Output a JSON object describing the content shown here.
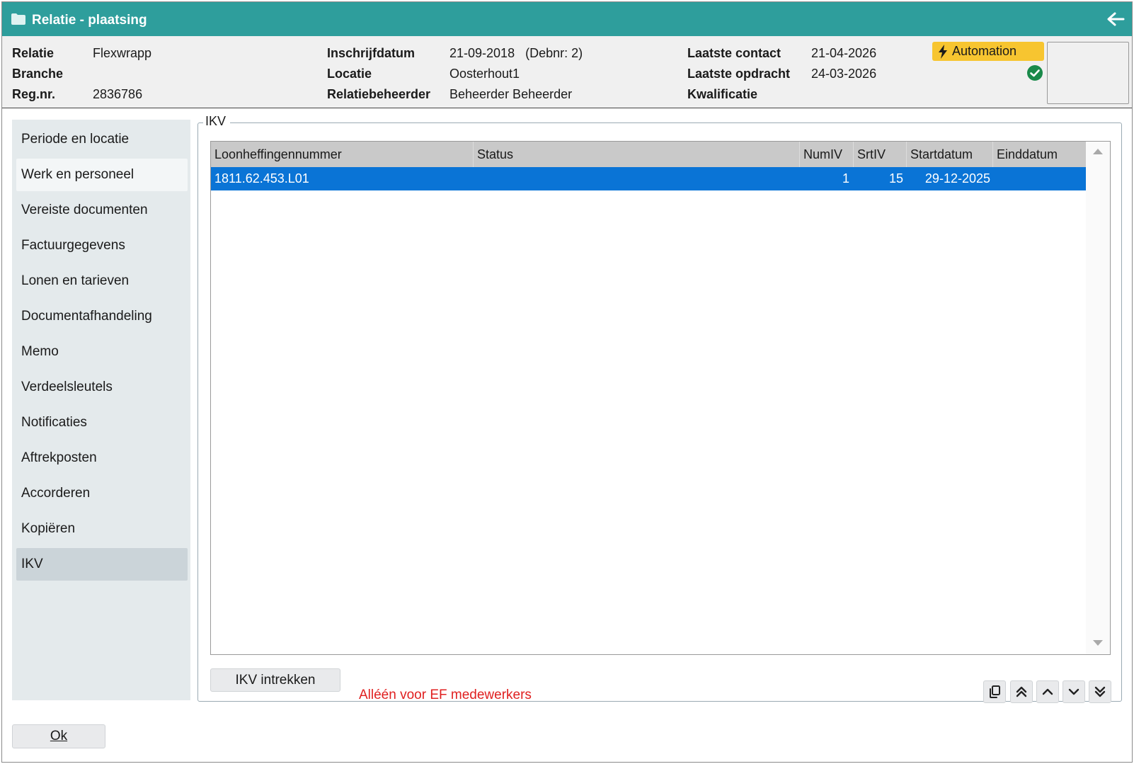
{
  "window": {
    "title": "Relatie - plaatsing"
  },
  "header": {
    "col1": [
      {
        "label": "Relatie",
        "value": "Flexwrapp"
      },
      {
        "label": "Branche",
        "value": ""
      },
      {
        "label": "Reg.nr.",
        "value": "2836786"
      }
    ],
    "col2": [
      {
        "label": "Inschrijfdatum",
        "value": "21-09-2018   (Debnr: 2)"
      },
      {
        "label": "Locatie",
        "value": "Oosterhout1"
      },
      {
        "label": "Relatiebeheerder",
        "value": "Beheerder Beheerder"
      }
    ],
    "col3": [
      {
        "label": "Laatste contact",
        "value": "21-04-2026"
      },
      {
        "label": "Laatste opdracht",
        "value": "24-03-2026"
      },
      {
        "label": "Kwalificatie",
        "value": ""
      }
    ],
    "badge": "Automation"
  },
  "sidebar": {
    "items": [
      {
        "label": "Periode en locatie"
      },
      {
        "label": "Werk en personeel"
      },
      {
        "label": "Vereiste documenten"
      },
      {
        "label": "Factuurgegevens"
      },
      {
        "label": "Lonen en tarieven"
      },
      {
        "label": "Documentafhandeling"
      },
      {
        "label": "Memo"
      },
      {
        "label": "Verdeelsleutels"
      },
      {
        "label": "Notificaties"
      },
      {
        "label": "Aftrekposten"
      },
      {
        "label": "Accorderen"
      },
      {
        "label": "Kopiëren"
      },
      {
        "label": "IKV"
      }
    ],
    "active": "IKV"
  },
  "ikv": {
    "title": "IKV",
    "columns": [
      "Loonheffingennummer",
      "Status",
      "NumIV",
      "SrtIV",
      "Startdatum",
      "Einddatum"
    ],
    "rows": [
      {
        "loonheffingennummer": "1811.62.453.L01",
        "status": "",
        "numiv": "1",
        "srtiv": "15",
        "startdatum": "29-12-2025",
        "einddatum": ""
      }
    ],
    "revoke_button": "IKV intrekken",
    "note": "Alléén voor EF medewerkers"
  },
  "footer": {
    "ok_label": "Ok"
  },
  "colors": {
    "titlebar": "#2e9e9c",
    "selection": "#0a74d6",
    "badge": "#f7c530",
    "note": "#e02020",
    "check": "#1a8a4a"
  }
}
